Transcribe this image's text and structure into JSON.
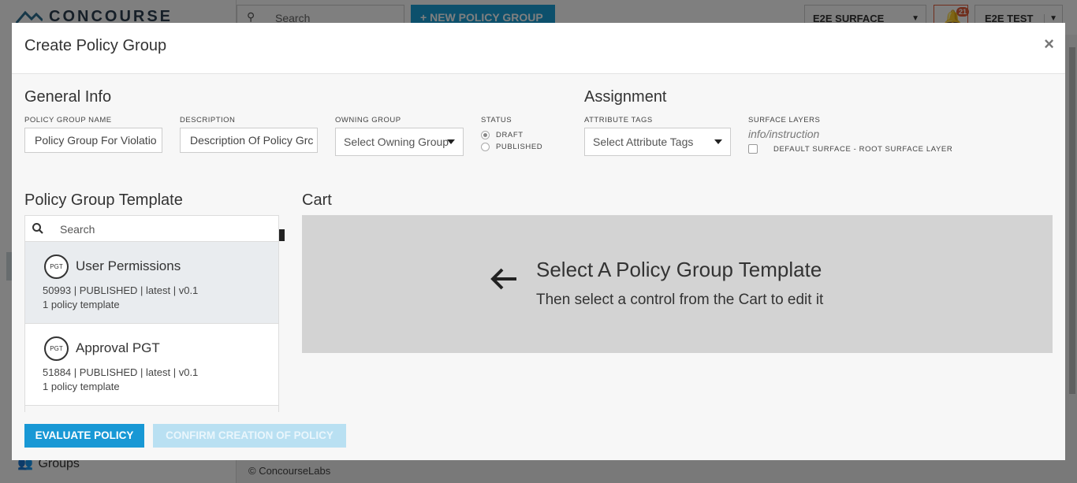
{
  "background": {
    "brand": "CONCOURSE",
    "search_placeholder": "Search",
    "new_policy_group_label": "NEW POLICY GROUP",
    "surface_selector": "E2E SURFACE",
    "notification_count": "21",
    "user_menu": "E2E TEST",
    "groups_nav": "Groups",
    "footer": "© ConcourseLabs"
  },
  "modal": {
    "title": "Create Policy Group",
    "close_glyph": "×",
    "general_info": {
      "heading": "General Info",
      "policy_group_name_label": "POLICY GROUP NAME",
      "policy_group_name_value": "Policy Group For Violatio",
      "description_label": "DESCRIPTION",
      "description_value": "Description Of Policy Grc",
      "owning_group_label": "OWNING GROUP",
      "owning_group_placeholder": "Select Owning Group",
      "status_label": "STATUS",
      "status_options": [
        "DRAFT",
        "PUBLISHED"
      ],
      "status_selected": "DRAFT"
    },
    "assignment": {
      "heading": "Assignment",
      "attribute_tags_label": "ATTRIBUTE TAGS",
      "attribute_tags_placeholder": "Select Attribute Tags",
      "surface_layers_label": "SURFACE LAYERS",
      "surface_layers_hint": "info/instruction",
      "surface_layer_option": "DEFAULT SURFACE - ROOT SURFACE LAYER"
    },
    "template": {
      "heading": "Policy Group Template",
      "search_placeholder": "Search",
      "badge_text": "PGT",
      "items": [
        {
          "name": "User Permissions",
          "meta": "50993 | PUBLISHED | latest | v0.1",
          "count": "1 policy template"
        },
        {
          "name": "Approval PGT",
          "meta": "51884 | PUBLISHED | latest | v0.1",
          "count": "1 policy template"
        }
      ]
    },
    "cart": {
      "heading": "Cart",
      "empty_title": "Select A Policy Group Template",
      "empty_subtitle": "Then select a control from the Cart to edit it"
    },
    "actions": {
      "evaluate_label": "EVALUATE POLICY",
      "confirm_label": "CONFIRM CREATION OF POLICY"
    }
  },
  "colors": {
    "accent": "#1898d5",
    "accent_disabled": "#b9e0f2",
    "notification": "#e05c3a",
    "cart_bg": "#d3d3d3"
  }
}
